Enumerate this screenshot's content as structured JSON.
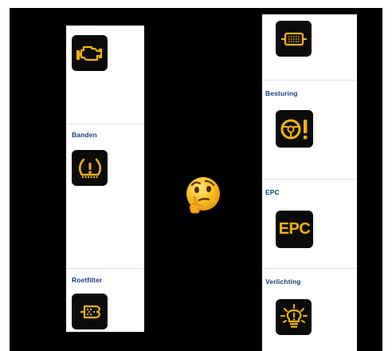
{
  "left_panel": {
    "sections": [
      {
        "label": "",
        "icon": "engine-warning-icon"
      },
      {
        "label": "Banden",
        "icon": "tire-pressure-icon"
      },
      {
        "label": "Roetfilter",
        "icon": "particulate-filter-icon"
      }
    ]
  },
  "right_panel": {
    "sections": [
      {
        "label": "",
        "icon": "exhaust-filter-icon"
      },
      {
        "label": "Besturing",
        "icon": "steering-warning-icon"
      },
      {
        "label": "EPC",
        "icon": "epc-icon",
        "icon_text": "EPC"
      },
      {
        "label": "Verlichting",
        "icon": "light-bulb-warning-icon"
      }
    ]
  },
  "center": {
    "icon": "thinking-face-emoji"
  },
  "colors": {
    "background": "#000000",
    "panel": "#ffffff",
    "label": "#15407e",
    "warning_amber": "#f2b20b",
    "tile": "#0b0b0b"
  }
}
